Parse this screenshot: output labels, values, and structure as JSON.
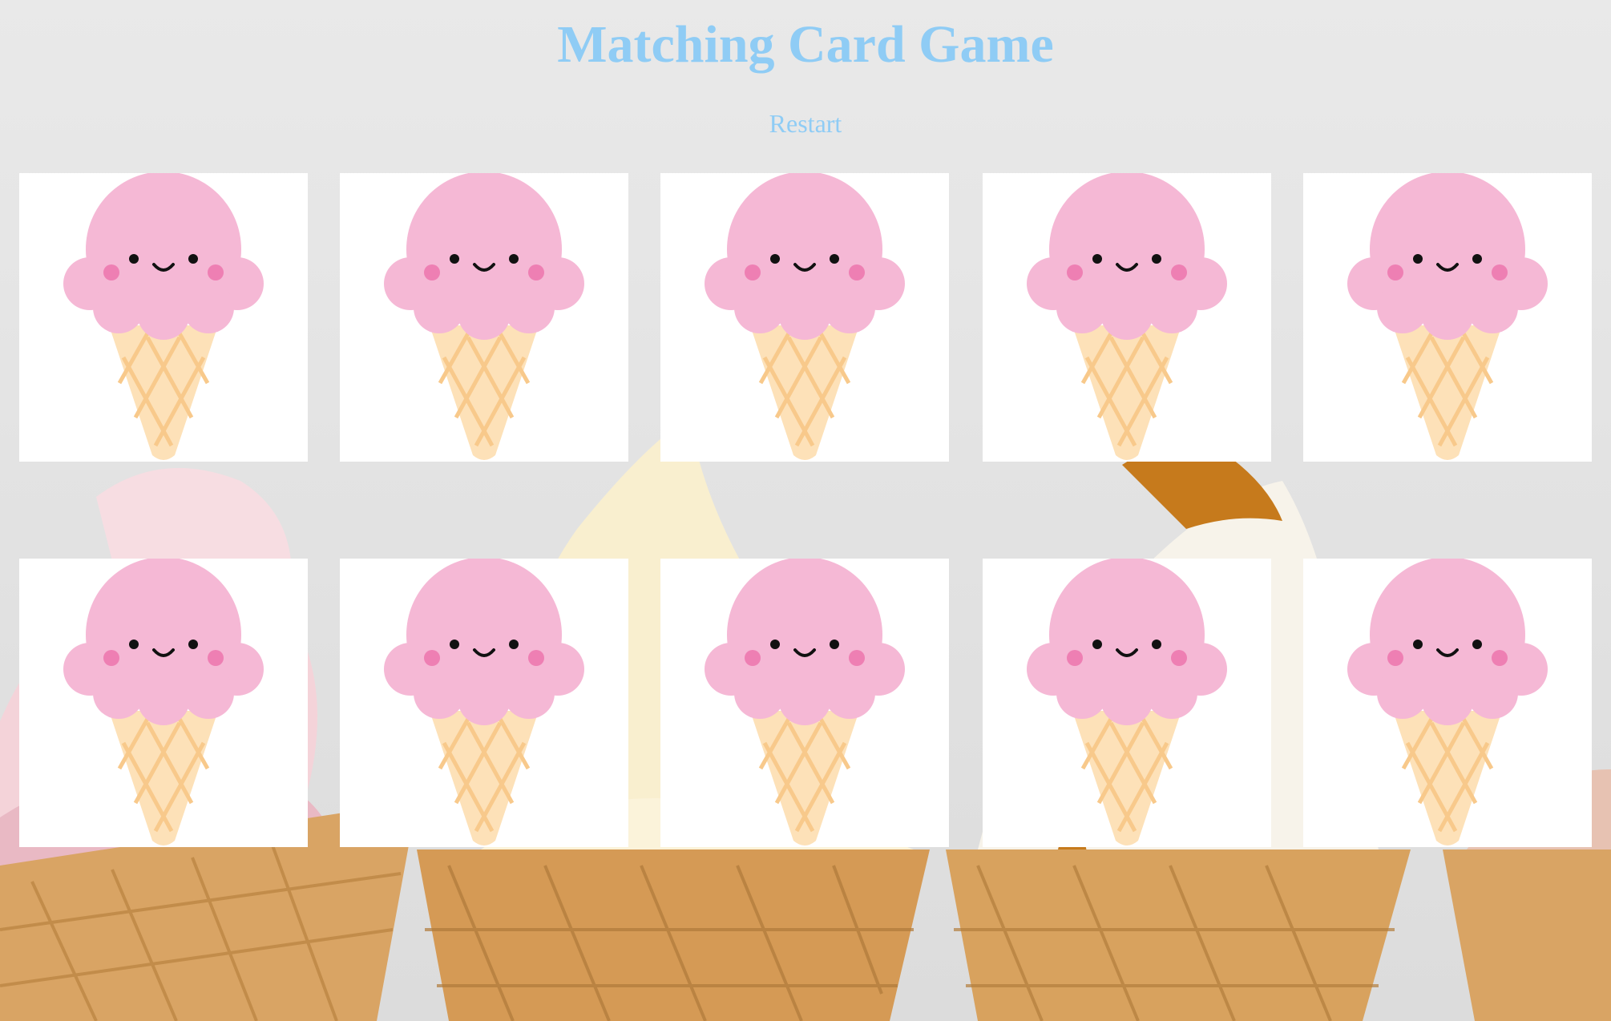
{
  "game": {
    "title": "Matching Card Game",
    "restart_label": "Restart"
  },
  "board": {
    "rows": 2,
    "columns": 5,
    "cards": [
      {
        "state": "face-down",
        "icon": "ice-cream-cone-icon"
      },
      {
        "state": "face-down",
        "icon": "ice-cream-cone-icon"
      },
      {
        "state": "face-down",
        "icon": "ice-cream-cone-icon"
      },
      {
        "state": "face-down",
        "icon": "ice-cream-cone-icon"
      },
      {
        "state": "face-down",
        "icon": "ice-cream-cone-icon"
      },
      {
        "state": "face-down",
        "icon": "ice-cream-cone-icon"
      },
      {
        "state": "face-down",
        "icon": "ice-cream-cone-icon"
      },
      {
        "state": "face-down",
        "icon": "ice-cream-cone-icon"
      },
      {
        "state": "face-down",
        "icon": "ice-cream-cone-icon"
      },
      {
        "state": "face-down",
        "icon": "ice-cream-cone-icon"
      }
    ]
  },
  "colors": {
    "accent": "#8fccf5",
    "card_background": "#ffffff",
    "scoop": "#f5b8d5",
    "cheek": "#ee7fb3",
    "cone": "#fde1b8",
    "cone_lines": "#f8c98b"
  }
}
